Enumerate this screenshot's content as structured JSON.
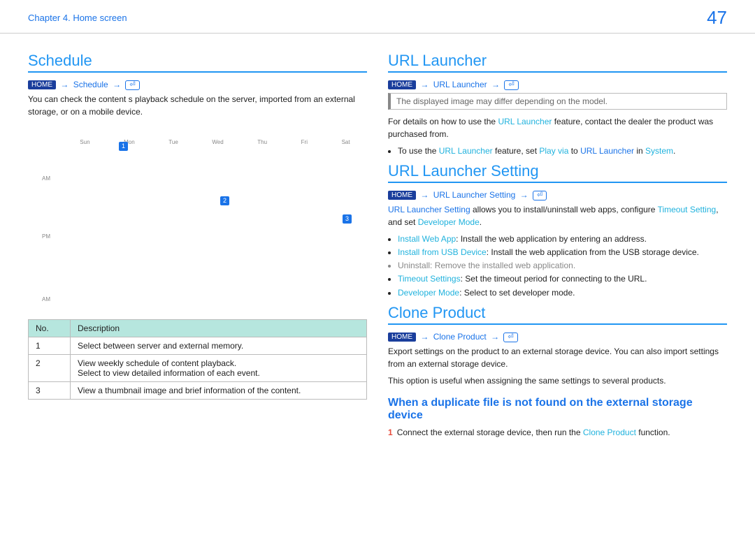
{
  "header": {
    "chapter": "Chapter 4. Home screen",
    "page": "47"
  },
  "left": {
    "schedule": {
      "title": "Schedule",
      "home_label": "HOME",
      "path_item": "Schedule",
      "enter_glyph": "⏎",
      "arrow": "→",
      "intro": "You can check the content s playback schedule on the server, imported from an external storage, or on a mobile device.",
      "graphic": {
        "days": [
          "Sun",
          "Mon",
          "Tue",
          "Wed",
          "Thu",
          "Fri",
          "Sat"
        ],
        "ylabels": [
          "AM",
          "PM",
          "AM"
        ],
        "callouts": [
          "1",
          "2",
          "3"
        ]
      },
      "table": {
        "headers": [
          "No.",
          "Description"
        ],
        "rows": [
          {
            "no": "1",
            "desc": "Select between server and external memory."
          },
          {
            "no": "2",
            "desc": "View weekly schedule of content playback.\nSelect to view detailed information of each event."
          },
          {
            "no": "3",
            "desc": "View a thumbnail image and brief information of the content."
          }
        ]
      }
    }
  },
  "right": {
    "urllauncher": {
      "title": "URL Launcher",
      "home_label": "HOME",
      "path_item": "URL Launcher",
      "enter_glyph": "⏎",
      "arrow": "→",
      "note": "The displayed image may differ depending on the model.",
      "p1_a": "For details on how to use the ",
      "p1_link": "URL Launcher",
      "p1_b": " feature, contact the dealer the product was purchased from.",
      "bullet_pre": "To use the ",
      "bullet_link1": "URL Launcher",
      "bullet_mid": " feature, set ",
      "bullet_link2": "Play via",
      "bullet_mid2": " to ",
      "bullet_link3": "URL Launcher",
      "bullet_mid3": " in ",
      "bullet_link4": "System",
      "bullet_end": "."
    },
    "urlsetting": {
      "title": "URL Launcher Setting",
      "home_label": "HOME",
      "path_item": "URL Launcher Setting",
      "enter_glyph": "⏎",
      "arrow": "→",
      "p1_link": "URL Launcher Setting",
      "p1_a": " allows you to install/uninstall web apps, configure ",
      "p1_link2": "Timeout Setting",
      "p1_b": ", and set ",
      "p1_link3": "Developer Mode",
      "p1_c": ".",
      "items": [
        {
          "k": "Install Web App",
          "v": ": Install the web application by entering an address."
        },
        {
          "k": "Install from USB Device",
          "v": ": Install the web application from the USB storage device."
        },
        {
          "k": "Uninstall",
          "v": ": Remove the installed web application.",
          "grey": true
        },
        {
          "k": "Timeout Settings",
          "v": ": Set the timeout period for connecting to the URL."
        },
        {
          "k": "Developer Mode",
          "v": ": Select to set developer mode."
        }
      ]
    },
    "clone": {
      "title": "Clone Product",
      "home_label": "HOME",
      "path_item": "Clone Product",
      "enter_glyph": "⏎",
      "arrow": "→",
      "p1": "Export settings on the product to an external storage device. You can also import settings from an external storage device.",
      "p2": "This option is useful when assigning the same settings to several products.",
      "subhead": "When a duplicate file is not found on the external storage device",
      "step_n": "1",
      "step_a": "Connect the external storage device, then run the ",
      "step_link": "Clone Product",
      "step_b": " function."
    }
  }
}
